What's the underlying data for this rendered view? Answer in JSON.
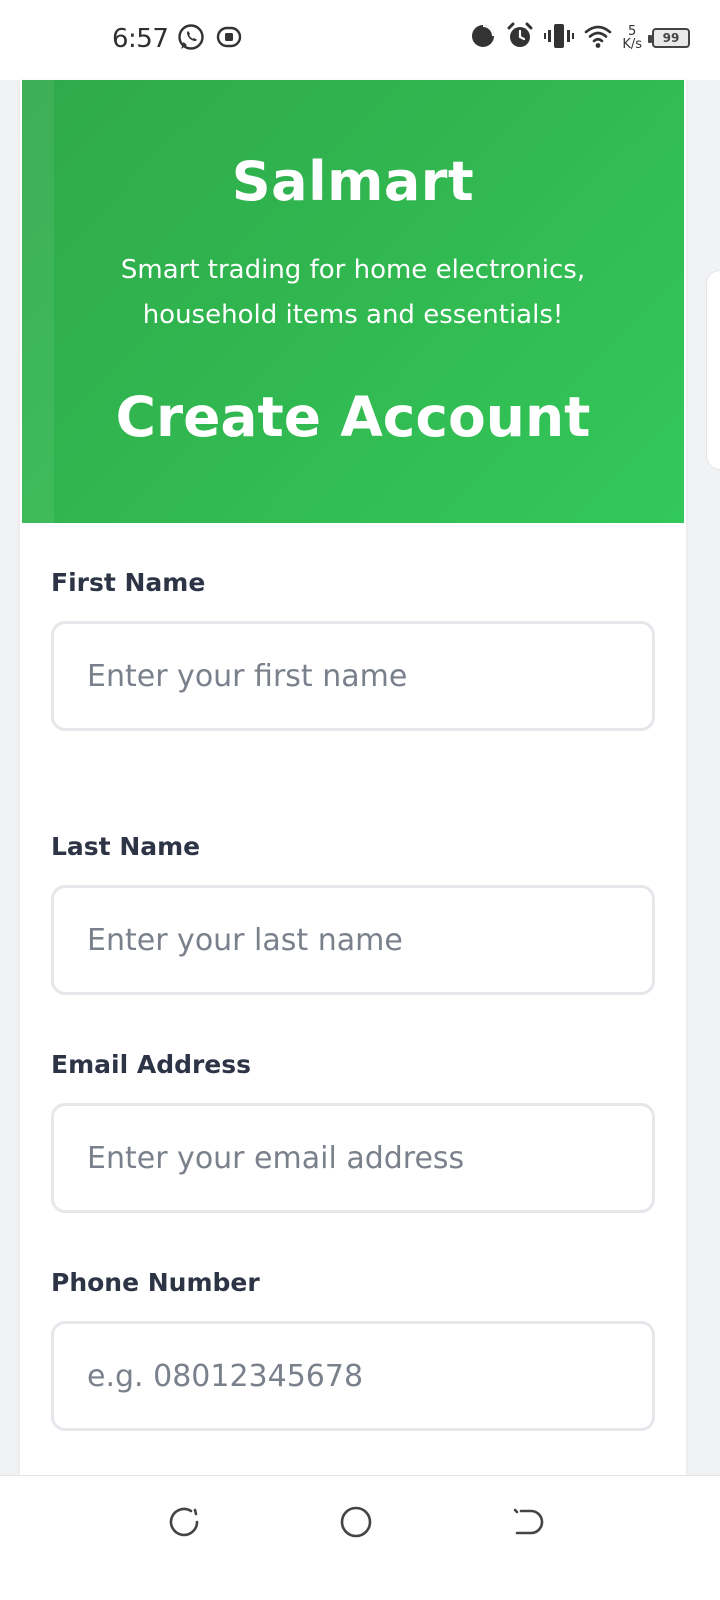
{
  "status_bar": {
    "time": "6:57",
    "net_speed_value": "5",
    "net_speed_unit": "K/s",
    "battery": "99",
    "left_icons": [
      "whatsapp-icon",
      "download-notification-icon"
    ],
    "right_icons": [
      "data-usage-icon",
      "alarm-icon",
      "vibrate-icon",
      "wifi-icon",
      "battery-icon"
    ]
  },
  "hero": {
    "brand": "Salmart",
    "tagline": "Smart trading for home electronics, household items and essentials!",
    "title": "Create Account",
    "gradient_start": "#2fa94b",
    "gradient_end": "#33c85a"
  },
  "form": {
    "first_name": {
      "label": "First Name",
      "placeholder": "Enter your first name",
      "value": ""
    },
    "last_name": {
      "label": "Last Name",
      "placeholder": "Enter your last name",
      "value": ""
    },
    "email": {
      "label": "Email Address",
      "placeholder": "Enter your email address",
      "value": ""
    },
    "phone": {
      "label": "Phone Number",
      "placeholder": "e.g. 08012345678",
      "value": ""
    }
  },
  "nav_bar": {
    "buttons": [
      "recent-apps-icon",
      "home-icon",
      "back-icon"
    ]
  },
  "colors": {
    "label": "#2c3446",
    "placeholder": "#7b818c",
    "input_border": "#e5e7eb",
    "hero_green": "#31b850"
  }
}
